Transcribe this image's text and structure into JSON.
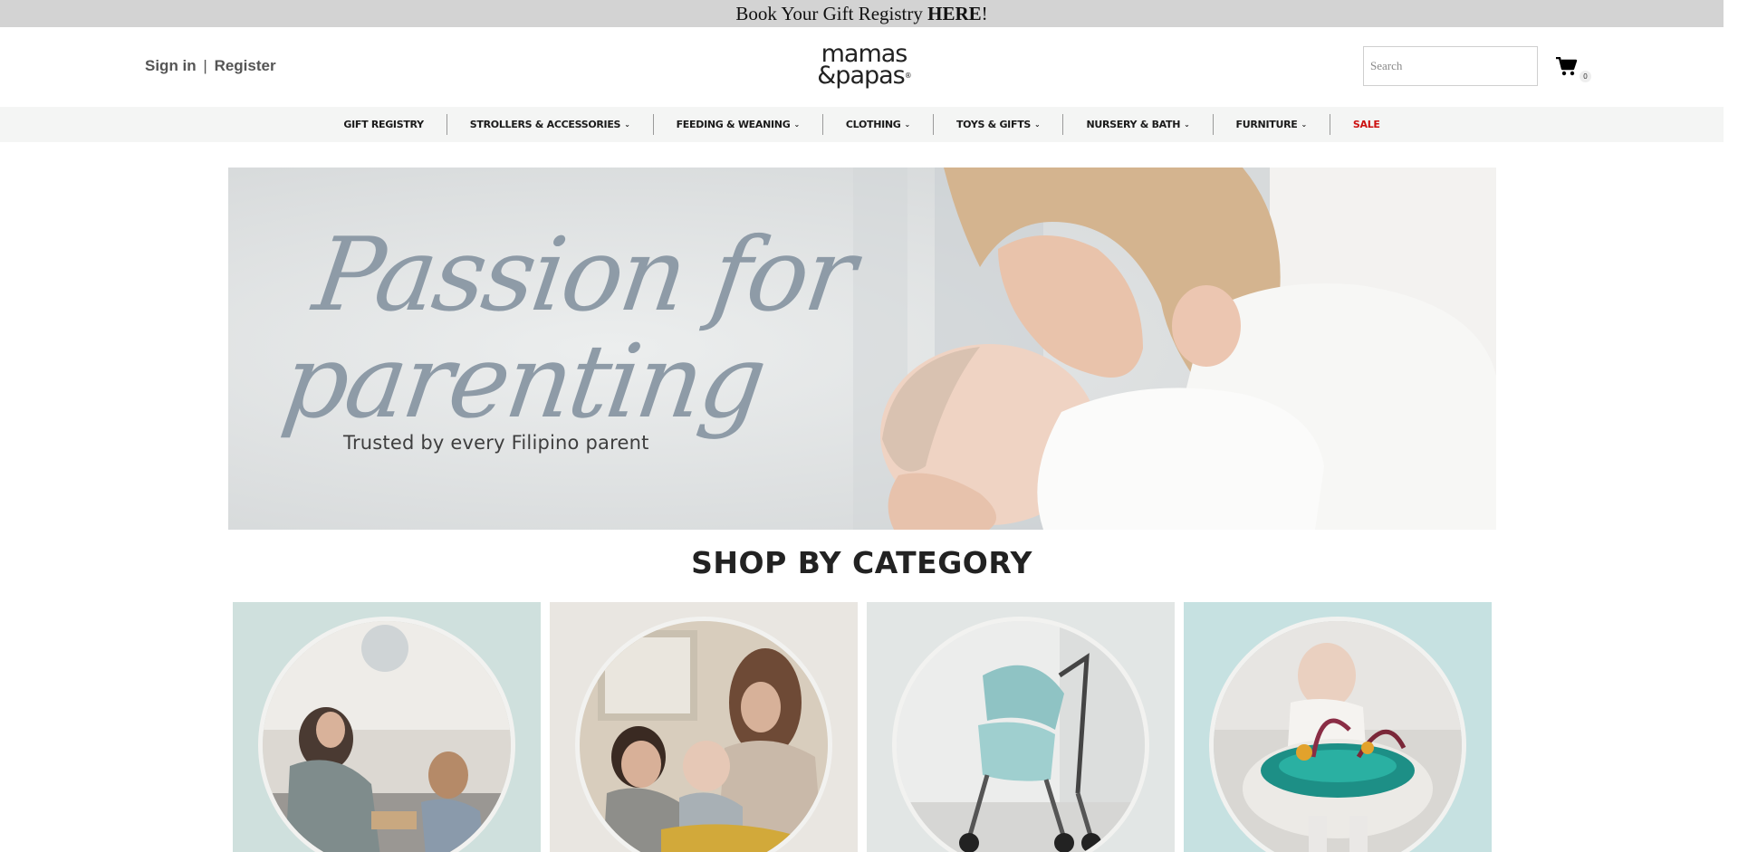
{
  "promo": {
    "text": "Book Your Gift Registry ",
    "link": "HERE",
    "suffix": "!"
  },
  "header": {
    "sign_in": "Sign in",
    "separator": "|",
    "register": "Register",
    "logo_line1": "mamas",
    "logo_line2": "&papas",
    "logo_mark": "®",
    "search_placeholder": "Search",
    "cart_count": "0",
    "cart_icon": "shopping-cart-icon"
  },
  "nav": {
    "items": [
      {
        "label": "GIFT REGISTRY",
        "dropdown": false
      },
      {
        "label": "STROLLERS & ACCESSORIES",
        "dropdown": true
      },
      {
        "label": "FEEDING & WEANING",
        "dropdown": true
      },
      {
        "label": "CLOTHING",
        "dropdown": true
      },
      {
        "label": "TOYS & GIFTS",
        "dropdown": true
      },
      {
        "label": "NURSERY & BATH",
        "dropdown": true
      },
      {
        "label": "FURNITURE",
        "dropdown": true
      },
      {
        "label": "SALE",
        "dropdown": false
      }
    ],
    "caret": "⌄",
    "sale_color": "#cc1010"
  },
  "hero": {
    "headline_line1": "Passion for",
    "headline_line2": "parenting",
    "subtitle": "Trusted by every Filipino parent",
    "headline_color": "#8e9ba7"
  },
  "categories": {
    "title": "SHOP BY CATEGORY",
    "cards": [
      {
        "image": "family-playing-on-floor",
        "bg": "#cfe0dd"
      },
      {
        "image": "mother-with-children",
        "bg": "#e9e6e1"
      },
      {
        "image": "mint-stroller",
        "bg": "#e2e6e5"
      },
      {
        "image": "baby-in-activity-seat",
        "bg": "#c6e1e1"
      }
    ]
  }
}
